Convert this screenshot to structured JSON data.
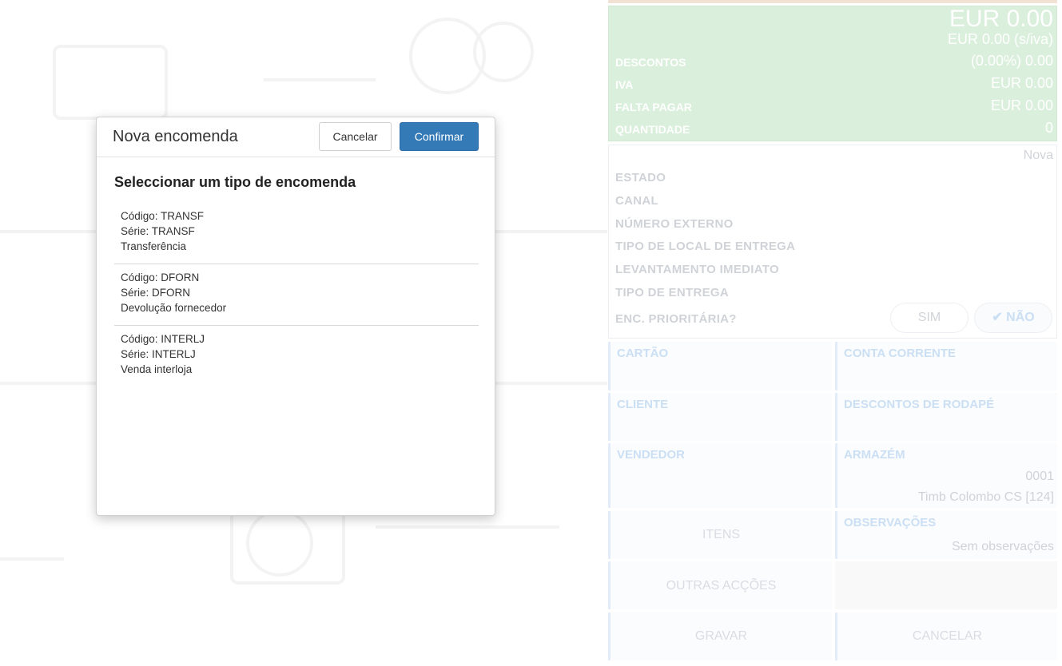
{
  "totals": {
    "total": "EUR 0.00",
    "total_no_vat": "EUR 0.00 (s/iva)",
    "rows": [
      {
        "label": "DESCONTOS",
        "value": "(0.00%) 0.00"
      },
      {
        "label": "IVA",
        "value": "EUR 0.00"
      },
      {
        "label": "FALTA PAGAR",
        "value": "EUR 0.00"
      },
      {
        "label": "QUANTIDADE",
        "value": "0"
      }
    ]
  },
  "order": {
    "status": "Nova",
    "fields": [
      "ESTADO",
      "CANAL",
      "NÚMERO EXTERNO",
      "TIPO DE LOCAL DE ENTREGA",
      "LEVANTAMENTO IMEDIATO",
      "TIPO DE ENTREGA",
      "ENC. PRIORITÁRIA?"
    ],
    "yes_label": "SIM",
    "no_label": "NÃO"
  },
  "tiles": {
    "cartao": "CARTÃO",
    "conta_corrente": "CONTA CORRENTE",
    "cliente": "CLIENTE",
    "descontos_rodape": "DESCONTOS DE RODAPÉ",
    "vendedor": "VENDEDOR",
    "armazem": "ARMAZÉM",
    "armazem_code": "0001",
    "armazem_name": "Timb Colombo CS [124]",
    "itens": "ITENS",
    "observacoes": "OBSERVAÇÕES",
    "observacoes_value": "Sem observações",
    "outras_accoes": "OUTRAS ACÇÕES",
    "gravar": "GRAVAR",
    "cancelar": "CANCELAR"
  },
  "modal": {
    "title": "Nova encomenda",
    "cancel_label": "Cancelar",
    "confirm_label": "Confirmar",
    "subtitle": "Seleccionar um tipo de encomenda",
    "items": [
      {
        "codigo": "Código: TRANSF",
        "serie": "Série: TRANSF",
        "descricao": "Transferência"
      },
      {
        "codigo": "Código: DFORN",
        "serie": "Série: DFORN",
        "descricao": "Devolução fornecedor"
      },
      {
        "codigo": "Código: INTERLJ",
        "serie": "Série: INTERLJ",
        "descricao": "Venda interloja"
      }
    ]
  }
}
